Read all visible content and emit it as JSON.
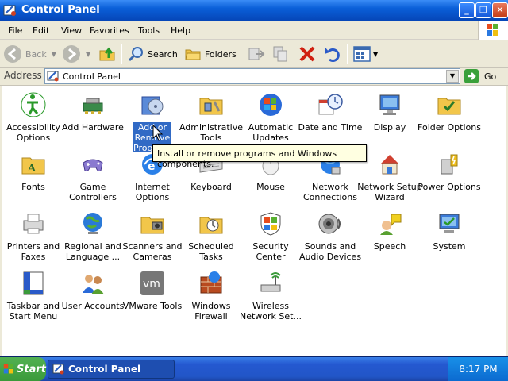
{
  "window": {
    "title": "Control Panel",
    "icon": "control-panel-icon"
  },
  "window_buttons": {
    "minimize": "_",
    "restore": "❐",
    "close": "✕"
  },
  "menu": [
    "File",
    "Edit",
    "View",
    "Favorites",
    "Tools",
    "Help"
  ],
  "toolbar": {
    "back": "Back",
    "search": "Search",
    "folders": "Folders"
  },
  "address": {
    "label": "Address",
    "value": "Control Panel",
    "go": "Go"
  },
  "items": [
    {
      "label": "Accessibility Options",
      "icon": "accessibility-icon"
    },
    {
      "label": "Add Hardware",
      "icon": "add-hardware-icon"
    },
    {
      "label": "Add or Remove Programs",
      "icon": "add-remove-programs-icon",
      "selected": true
    },
    {
      "label": "Administrative Tools",
      "icon": "administrative-tools-icon"
    },
    {
      "label": "Automatic Updates",
      "icon": "automatic-updates-icon"
    },
    {
      "label": "Date and Time",
      "icon": "date-time-icon"
    },
    {
      "label": "Display",
      "icon": "display-icon"
    },
    {
      "label": "Folder Options",
      "icon": "folder-options-icon"
    },
    {
      "label": "Fonts",
      "icon": "fonts-icon"
    },
    {
      "label": "Game Controllers",
      "icon": "game-controllers-icon"
    },
    {
      "label": "Internet Options",
      "icon": "internet-options-icon"
    },
    {
      "label": "Keyboard",
      "icon": "keyboard-icon"
    },
    {
      "label": "Mouse",
      "icon": "mouse-icon"
    },
    {
      "label": "Network Connections",
      "icon": "network-connections-icon"
    },
    {
      "label": "Network Setup Wizard",
      "icon": "network-setup-wizard-icon"
    },
    {
      "label": "Power Options",
      "icon": "power-options-icon"
    },
    {
      "label": "Printers and Faxes",
      "icon": "printers-faxes-icon"
    },
    {
      "label": "Regional and Language ...",
      "icon": "regional-language-icon"
    },
    {
      "label": "Scanners and Cameras",
      "icon": "scanners-cameras-icon"
    },
    {
      "label": "Scheduled Tasks",
      "icon": "scheduled-tasks-icon"
    },
    {
      "label": "Security Center",
      "icon": "security-center-icon"
    },
    {
      "label": "Sounds and Audio Devices",
      "icon": "sounds-audio-icon"
    },
    {
      "label": "Speech",
      "icon": "speech-icon"
    },
    {
      "label": "System",
      "icon": "system-icon"
    },
    {
      "label": "Taskbar and Start Menu",
      "icon": "taskbar-start-menu-icon"
    },
    {
      "label": "User Accounts",
      "icon": "user-accounts-icon"
    },
    {
      "label": "VMware Tools",
      "icon": "vmware-tools-icon"
    },
    {
      "label": "Windows Firewall",
      "icon": "windows-firewall-icon"
    },
    {
      "label": "Wireless Network Set...",
      "icon": "wireless-network-icon"
    }
  ],
  "tooltip": "Install or remove programs and Windows components.",
  "taskbar": {
    "start": "Start",
    "task": "Control Panel",
    "clock": "8:17 PM"
  },
  "colors": {
    "title_blue": "#0a5fd8",
    "selection": "#316ac5",
    "start_green": "#3a9a3a",
    "chrome": "#ece9d8"
  }
}
